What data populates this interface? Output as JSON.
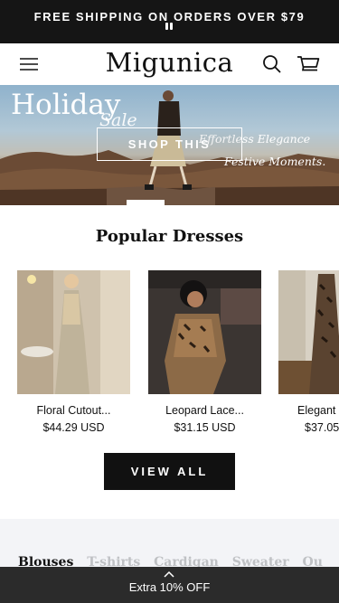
{
  "announcement": {
    "text": "FREE SHIPPING ON ORDERS OVER $79"
  },
  "header": {
    "logo": "Migunica",
    "icons": [
      "menu-icon",
      "search-icon",
      "cart-icon"
    ]
  },
  "hero": {
    "headline": "Holiday",
    "headline_sub": "Sale",
    "tagline_1": "Effortless Elegance",
    "tagline_2": "Festive Moments.",
    "button": "SHOP THIS"
  },
  "section": {
    "title": "Popular Dresses"
  },
  "products": [
    {
      "name": "Floral Cutout...",
      "price": "$44.29 USD"
    },
    {
      "name": "Leopard Lace...",
      "price": "$31.15 USD"
    },
    {
      "name": "Elegant",
      "price": "$37.05"
    }
  ],
  "view_all": "VIEW ALL",
  "categories": [
    "Blouses",
    "T-shirts",
    "Cardigan",
    "Sweater",
    "Ou"
  ],
  "promo": {
    "text": "Extra 10% OFF"
  },
  "colors": {
    "announcement_bg": "#151515",
    "promo_bg": "#2b2b2b",
    "button_bg": "#111111",
    "category_bg": "#f3f4f7"
  }
}
